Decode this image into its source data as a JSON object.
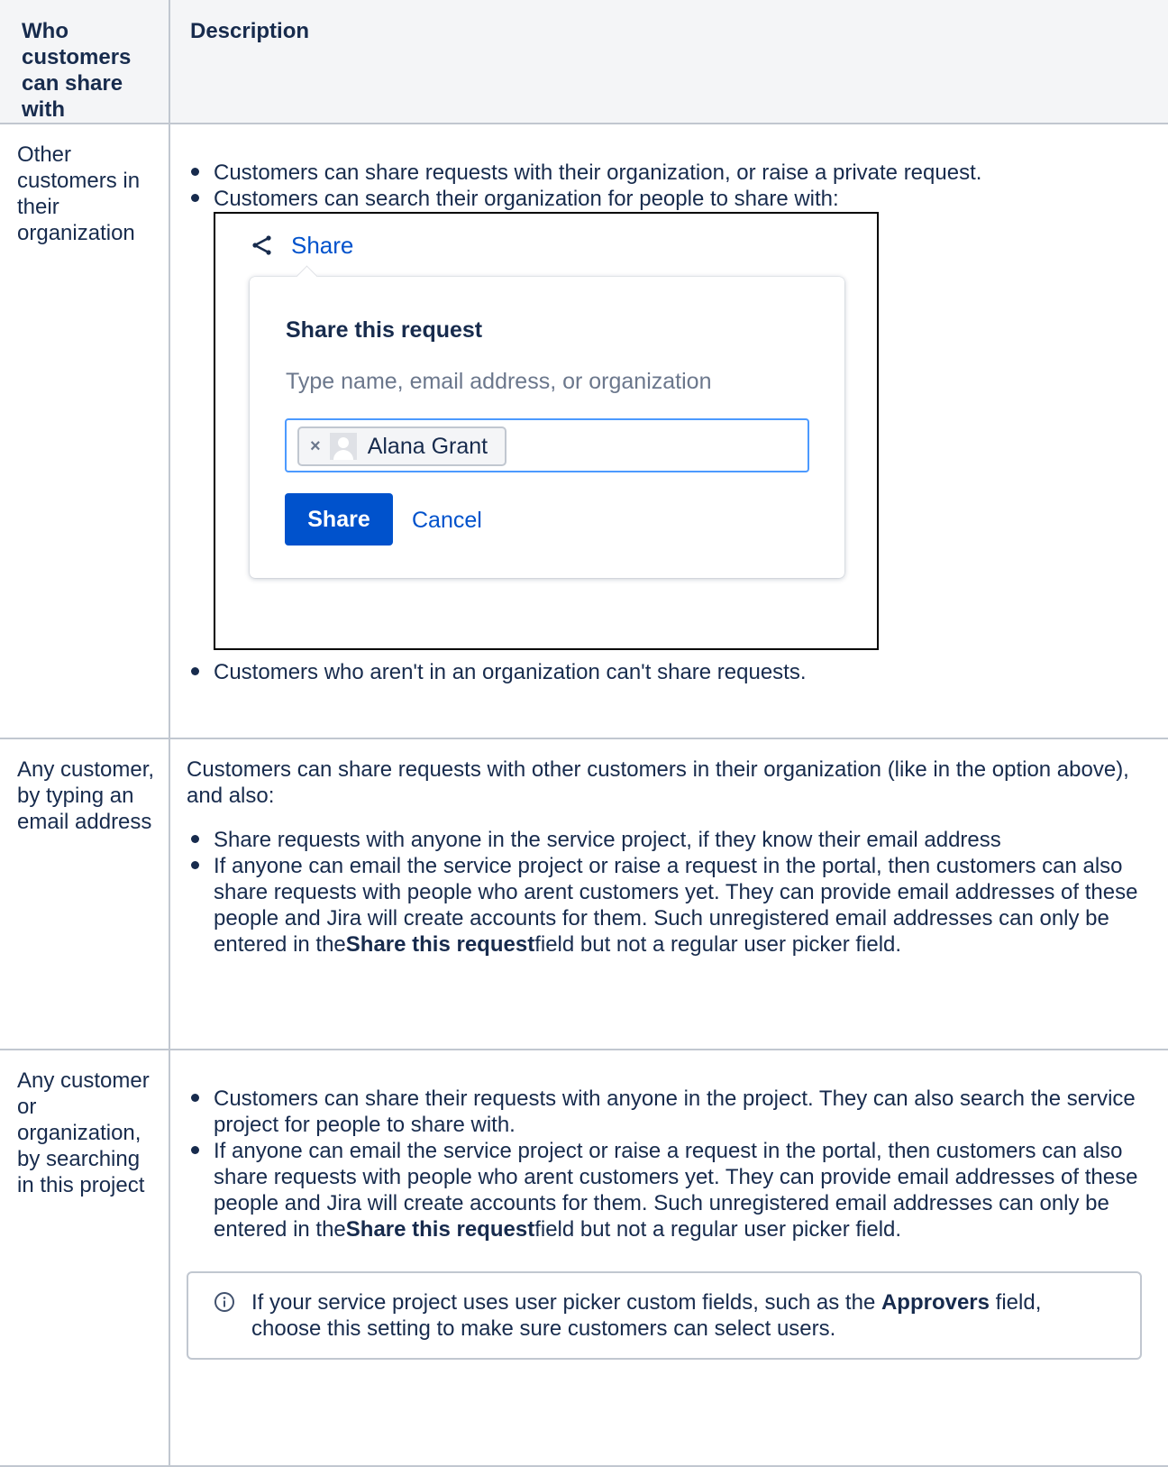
{
  "header": {
    "col1": "Who customers can share with",
    "col2": "Description"
  },
  "row1": {
    "who": "Other customers in their organization",
    "bullets": [
      "Customers can share requests with their organization, or raise a private request.",
      "Customers can search their organization for people to share with:"
    ],
    "after_bullet": "Customers who aren't in an organization can't share requests.",
    "screenshot": {
      "share_link": "Share",
      "popup_title": "Share this request",
      "placeholder": "Type name, email address, or organization",
      "chip_remove": "×",
      "chip_name": "Alana Grant",
      "share_button": "Share",
      "cancel_button": "Cancel"
    }
  },
  "row2": {
    "who": "Any customer, by typing an email address",
    "intro": "Customers can share requests with other customers in their organization (like in the option above), and also:",
    "bullet1": "Share requests with anyone in the service project, if they know their email address",
    "bullet2_pre": "If anyone can email the service project or raise a request in the portal, then customers can also share requests with people who arent customers yet. They can provide email addresses of these people and Jira will create accounts for them. Such unregistered email addresses can only be entered in the",
    "bullet2_bold": "Share this request",
    "bullet2_post": "field but not a regular user picker field."
  },
  "row3": {
    "who": "Any customer or organization, by searching in this project",
    "bullet1": "Customers can share their requests with anyone in the project. They can also search the service project for people to share with.",
    "bullet2_pre": "If anyone can email the service project or raise a request in the portal, then customers can also share requests with people who arent customers yet. They can provide email addresses of these people and Jira will create accounts for them. Such unregistered email addresses can only be entered in the",
    "bullet2_bold": "Share this request",
    "bullet2_post": "field but not a regular user picker field.",
    "info_pre": "If your service project uses user picker custom fields, such as the ",
    "info_bold": "Approvers",
    "info_post": " field, choose this setting to make sure customers can select users."
  },
  "colors": {
    "text": "#172b4d",
    "link": "#0052cc",
    "border": "#c1c7d0",
    "header_bg": "#f4f5f7"
  },
  "icons": [
    "share-icon",
    "info-icon",
    "avatar-icon"
  ]
}
